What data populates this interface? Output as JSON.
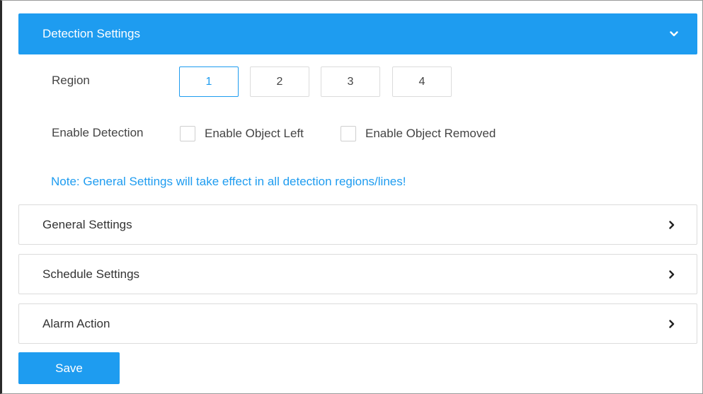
{
  "detection": {
    "header_title": "Detection Settings",
    "header_icon": "chevron-down-icon",
    "region_label": "Region",
    "regions": [
      "1",
      "2",
      "3",
      "4"
    ],
    "active_region": "1",
    "enable_label": "Enable Detection",
    "options": [
      {
        "label": "Enable Object Left",
        "checked": false
      },
      {
        "label": "Enable Object Removed",
        "checked": false
      }
    ],
    "note": "Note: General Settings will take effect in all detection regions/lines!"
  },
  "sections": [
    {
      "title": "General Settings",
      "icon": "chevron-right-icon"
    },
    {
      "title": "Schedule Settings",
      "icon": "chevron-right-icon"
    },
    {
      "title": "Alarm Action",
      "icon": "chevron-right-icon"
    }
  ],
  "actions": {
    "save_label": "Save"
  },
  "colors": {
    "accent": "#1e9cf0",
    "border": "#dcdcdc",
    "text": "#333333"
  }
}
